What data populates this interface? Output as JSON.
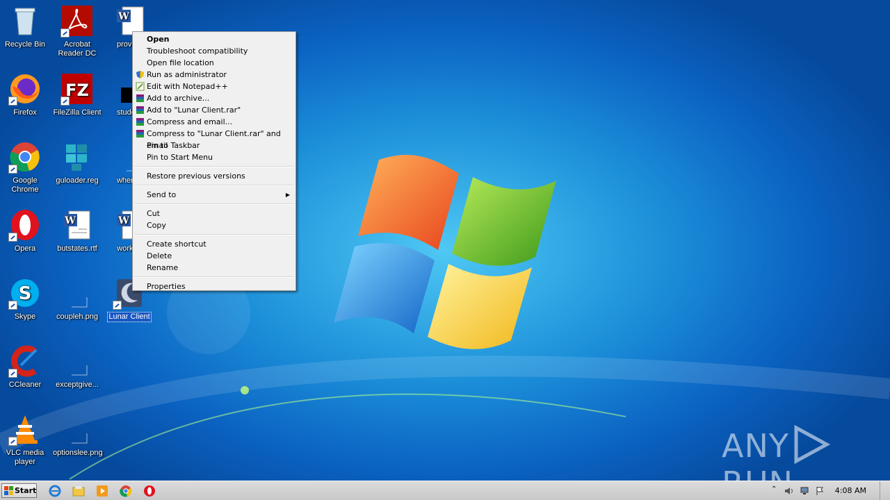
{
  "desktop_icons": [
    {
      "label": "Recycle Bin"
    },
    {
      "label": "Acrobat Reader DC"
    },
    {
      "label": "provide"
    },
    {
      "label": "Firefox"
    },
    {
      "label": "FileZilla Client"
    },
    {
      "label": "student"
    },
    {
      "label": "Google Chrome"
    },
    {
      "label": "guloader.reg"
    },
    {
      "label": "whereh"
    },
    {
      "label": "Opera"
    },
    {
      "label": "butstates.rtf"
    },
    {
      "label": "workstr"
    },
    {
      "label": "Skype"
    },
    {
      "label": "coupleh.png"
    },
    {
      "label": "Lunar Client"
    },
    {
      "label": "CCleaner"
    },
    {
      "label": "exceptgive..."
    },
    {
      "label": "VLC media player"
    },
    {
      "label": "optionslee.png"
    }
  ],
  "context_menu": {
    "items": [
      {
        "label": "Open"
      },
      {
        "label": "Troubleshoot compatibility"
      },
      {
        "label": "Open file location"
      },
      {
        "label": "Run as administrator"
      },
      {
        "label": "Edit with Notepad++"
      },
      {
        "label": "Add to archive..."
      },
      {
        "label": "Add to \"Lunar Client.rar\""
      },
      {
        "label": "Compress and email..."
      },
      {
        "label": "Compress to \"Lunar Client.rar\" and email"
      },
      {
        "label": "Pin to Taskbar"
      },
      {
        "label": "Pin to Start Menu"
      },
      {
        "label": "Restore previous versions"
      },
      {
        "label": "Send to"
      },
      {
        "label": "Cut"
      },
      {
        "label": "Copy"
      },
      {
        "label": "Create shortcut"
      },
      {
        "label": "Delete"
      },
      {
        "label": "Rename"
      },
      {
        "label": "Properties"
      }
    ]
  },
  "taskbar": {
    "start_label": "Start",
    "clock": "4:08 AM"
  },
  "watermark": {
    "left": "ANY",
    "right": "RUN"
  },
  "colors": {
    "selection": "#1a57c4",
    "desktop_blue": "#1c8fd9"
  }
}
